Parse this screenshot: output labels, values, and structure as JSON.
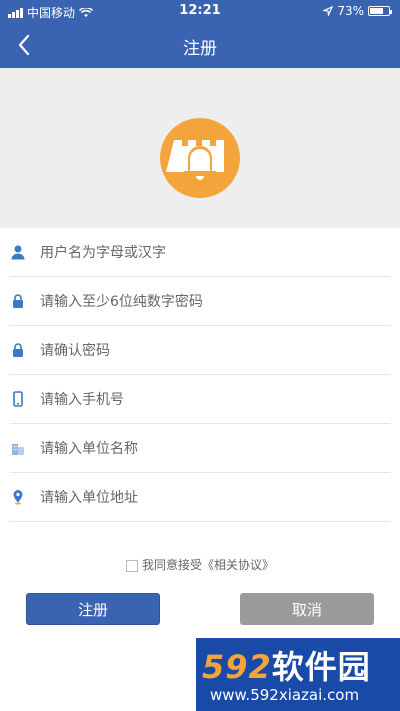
{
  "status_bar": {
    "carrier": "中国移动",
    "time": "12:21",
    "battery": "73%",
    "battery_level": 0.73
  },
  "nav": {
    "title": "注册",
    "back_icon": "chevron-left-icon"
  },
  "logo": {
    "icon": "castle-bell-logo",
    "color": "#f3a53b"
  },
  "form": {
    "username_placeholder": "用户名为字母或汉字",
    "password_placeholder": "请输入至少6位纯数字密码",
    "confirm_placeholder": "请确认密码",
    "phone_placeholder": "请输入手机号",
    "company_placeholder": "请输入单位名称",
    "address_placeholder": "请输入单位地址"
  },
  "agreement": {
    "text": "我同意接受《相关协议》"
  },
  "buttons": {
    "register": "注册",
    "cancel": "取消"
  },
  "watermark": {
    "number": "592",
    "name": "软件园",
    "url": "www.592xiazai.com"
  },
  "colors": {
    "primary": "#3a63b1",
    "secondary": "#9b9b9b",
    "accent": "#f3a53b"
  }
}
